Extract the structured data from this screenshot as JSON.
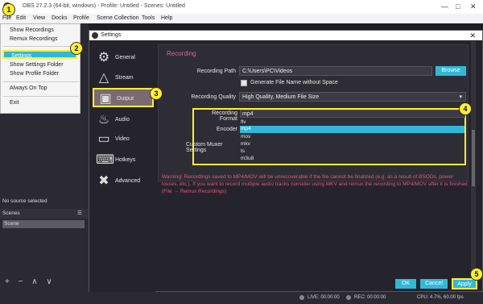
{
  "window": {
    "title": "OBS 27.2.3 (64-bit, windows) - Profile: Untitled - Scenes: Untitled"
  },
  "menubar": [
    "File",
    "Edit",
    "View",
    "Docks",
    "Profile",
    "Scene Collection",
    "Tools",
    "Help"
  ],
  "file_menu": {
    "items": [
      "Show Recordings",
      "Remux Recordings",
      "Settings",
      "Show Settings Folder",
      "Show Profile Folder",
      "Always On Top",
      "Exit"
    ],
    "selected": "Settings"
  },
  "left_panel": {
    "no_source": "No source selected",
    "scenes_header": "Scenes",
    "scene_item": "Scene",
    "bottom_controls": "+ − ∧ ∨"
  },
  "settings": {
    "title": "Settings",
    "sidebar": [
      "General",
      "Stream",
      "Output",
      "Audio",
      "Video",
      "Hotkeys",
      "Advanced"
    ],
    "selected_tab": "Output",
    "section": "Recording",
    "recording_path_label": "Recording Path",
    "recording_path_value": "C:\\Users\\PC\\Videos",
    "browse_button": "Browse",
    "generate_checkbox": "Generate File Name without Space",
    "recording_quality_label": "Recording Quality",
    "recording_quality_value": "High Quality, Medium File Size",
    "recording_format_label": "Recording Format",
    "recording_format_value": "mp4",
    "encoder_label": "Encoder",
    "custom_muxer_label": "Custom Muxer Settings",
    "format_options": [
      "flv",
      "mp4",
      "mov",
      "mkv",
      "ts",
      "m3u8"
    ],
    "format_selected": "mp4",
    "warning": "Warning: Recordings saved to MP4/MOV will be unrecoverable if the file cannot be finalized (e.g. as a result of BSODs, power losses, etc.). If you want to record multiple audio tracks consider using MKV and remux the recording to MP4/MOV after it is finished (File → Remux Recordings)",
    "ok": "OK",
    "cancel": "Cancel",
    "apply": "Apply"
  },
  "status": {
    "live": "LIVE: 00:00:00",
    "rec": "REC: 00:00:00",
    "cpu": "CPU: 4.7%, 60.00 fps"
  },
  "badges": [
    "1",
    "2",
    "3",
    "4",
    "5"
  ]
}
